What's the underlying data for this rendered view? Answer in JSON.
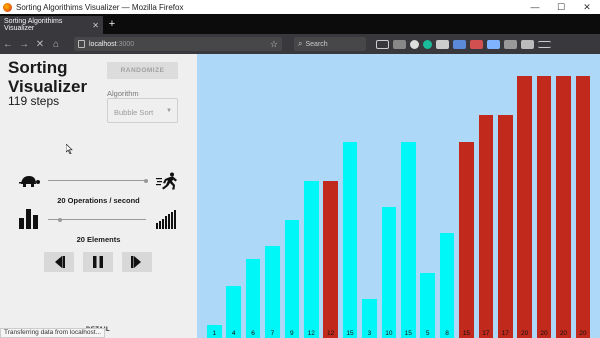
{
  "window": {
    "title": "Sorting Algorithims Visualizer — Mozilla Firefox",
    "minimize": "—",
    "maximize": "☐",
    "close": "✕"
  },
  "browser": {
    "tab_title": "Sorting Algorithims Visualizer",
    "tab_close": "✕",
    "new_tab": "+",
    "back": "←",
    "forward": "→",
    "stop": "✕",
    "home": "⌂",
    "url": "localhost",
    "url_port": ":3000",
    "bookmark_star": "☆",
    "search_placeholder": "Search",
    "search_glyph": "⌕",
    "status": "Transferring data from localhost..."
  },
  "app": {
    "title": "Sorting Visualizer",
    "steps": "119 steps",
    "randomize_label": "RANDOMIZE",
    "algorithm_label": "Algorithm",
    "algorithm_value": "Bubble Sort",
    "caret": "▼",
    "speed_label": "20 Operations / second",
    "elements_label": "20 Elements",
    "detail_label": "DETAIL",
    "speed_fraction": 1.0,
    "elements_fraction": 0.12
  },
  "colors": {
    "background": "#add8f7",
    "unsorted": "#00f7f7",
    "sorted": "#c0291c",
    "sidebar": "#efefef"
  },
  "chart_data": {
    "type": "bar",
    "values": [
      1,
      4,
      6,
      7,
      9,
      12,
      12,
      15,
      3,
      10,
      15,
      5,
      8,
      15,
      17,
      17,
      20,
      20,
      20,
      20
    ],
    "labels": [
      "1",
      "4",
      "6",
      "7",
      "9",
      "12",
      "12",
      "15",
      "3",
      "10",
      "15",
      "5",
      "8",
      "15",
      "17",
      "17",
      "20",
      "20",
      "20",
      "20"
    ],
    "sorted_flags": [
      false,
      false,
      false,
      false,
      false,
      false,
      true,
      false,
      false,
      false,
      false,
      false,
      false,
      true,
      true,
      true,
      true,
      true,
      true,
      true
    ],
    "ylim": [
      0,
      20
    ]
  }
}
